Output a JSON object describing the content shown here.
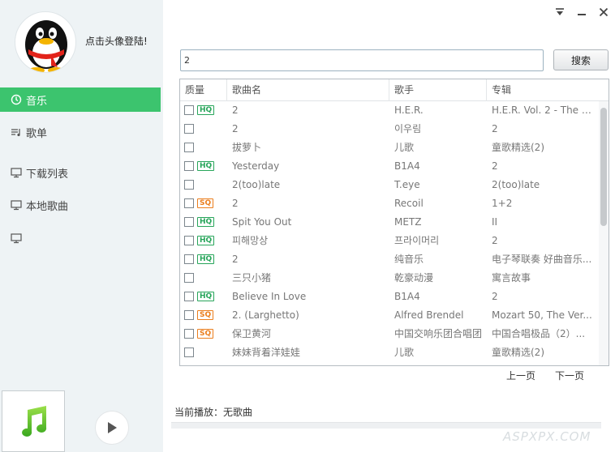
{
  "sidebar": {
    "login_text": "点击头像登陆!",
    "nav": [
      {
        "label": "音乐",
        "icon": "clock-icon",
        "active": true
      },
      {
        "label": "歌单",
        "icon": "playlist-icon",
        "active": false
      },
      {
        "label": "下载列表",
        "icon": "monitor-icon",
        "active": false
      },
      {
        "label": "本地歌曲",
        "icon": "monitor-icon",
        "active": false
      },
      {
        "label": "",
        "icon": "monitor-icon",
        "active": false
      }
    ]
  },
  "search": {
    "value": "2",
    "button_label": "搜索"
  },
  "table": {
    "headers": [
      "质量",
      "歌曲名",
      "歌手",
      "专辑"
    ],
    "rows": [
      {
        "quality": "HQ",
        "title": "2",
        "artist": "H.E.R.",
        "album": "H.E.R. Vol. 2 - The B..."
      },
      {
        "quality": "",
        "title": "2",
        "artist": "이우림",
        "album": "2"
      },
      {
        "quality": "",
        "title": "拔萝卜",
        "artist": "儿歌",
        "album": "童歌精选(2)"
      },
      {
        "quality": "HQ",
        "title": "Yesterday",
        "artist": "B1A4",
        "album": "2"
      },
      {
        "quality": "",
        "title": "2(too)late",
        "artist": "T.eye",
        "album": "2(too)late"
      },
      {
        "quality": "SQ",
        "title": "2",
        "artist": "Recoil",
        "album": "1+2"
      },
      {
        "quality": "HQ",
        "title": "Spit You Out",
        "artist": "METZ",
        "album": "II"
      },
      {
        "quality": "HQ",
        "title": "피해망상",
        "artist": "프라이머리",
        "album": "2"
      },
      {
        "quality": "HQ",
        "title": "2",
        "artist": "纯音乐",
        "album": "电子琴联奏 好曲音乐..."
      },
      {
        "quality": "",
        "title": "三只小猪",
        "artist": "乾豪动漫",
        "album": "寓言故事"
      },
      {
        "quality": "HQ",
        "title": "Believe In Love",
        "artist": "B1A4",
        "album": "2"
      },
      {
        "quality": "SQ",
        "title": "2. (Larghetto)",
        "artist": "Alfred Brendel",
        "album": "Mozart 50, The Ver..."
      },
      {
        "quality": "SQ",
        "title": "保卫黄河",
        "artist": "中国交响乐团合唱团",
        "album": "中国合唱极品（2）..."
      },
      {
        "quality": "",
        "title": "妹妹背着洋娃娃",
        "artist": "儿歌",
        "album": "童歌精选(2)"
      }
    ]
  },
  "pager": {
    "prev": "上一页",
    "next": "下一页"
  },
  "player": {
    "now_playing": "当前播放：无歌曲"
  },
  "watermark": "ASPXPX.COM",
  "colors": {
    "accent": "#3cc46e",
    "hq": "#27a55a",
    "sq": "#ea7d1c"
  }
}
